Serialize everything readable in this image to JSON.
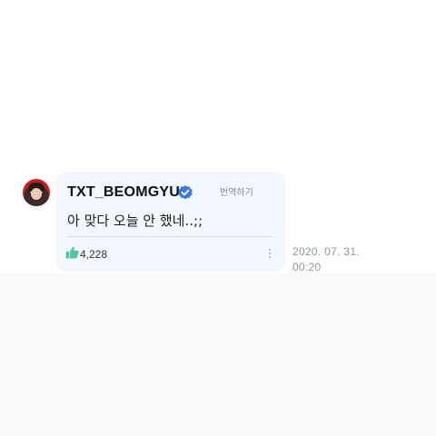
{
  "comment": {
    "username": "TXT_BEOMGYU",
    "verified_icon": "verified-badge-icon",
    "translate_label": "번역하기",
    "text": "아 맞다 오늘 안 했네..;;",
    "like_icon": "thumbs-up-icon",
    "like_count": "4,228",
    "more_icon": "more-vertical-icon",
    "date": "2020. 07. 31.",
    "time": "00:20"
  },
  "colors": {
    "bubble_background": "#f1f7fc",
    "verified_badge": "#3a7bd5",
    "like_icon": "#4fc7a2",
    "text": "#1e1e1e",
    "muted_text": "#8e959d"
  }
}
